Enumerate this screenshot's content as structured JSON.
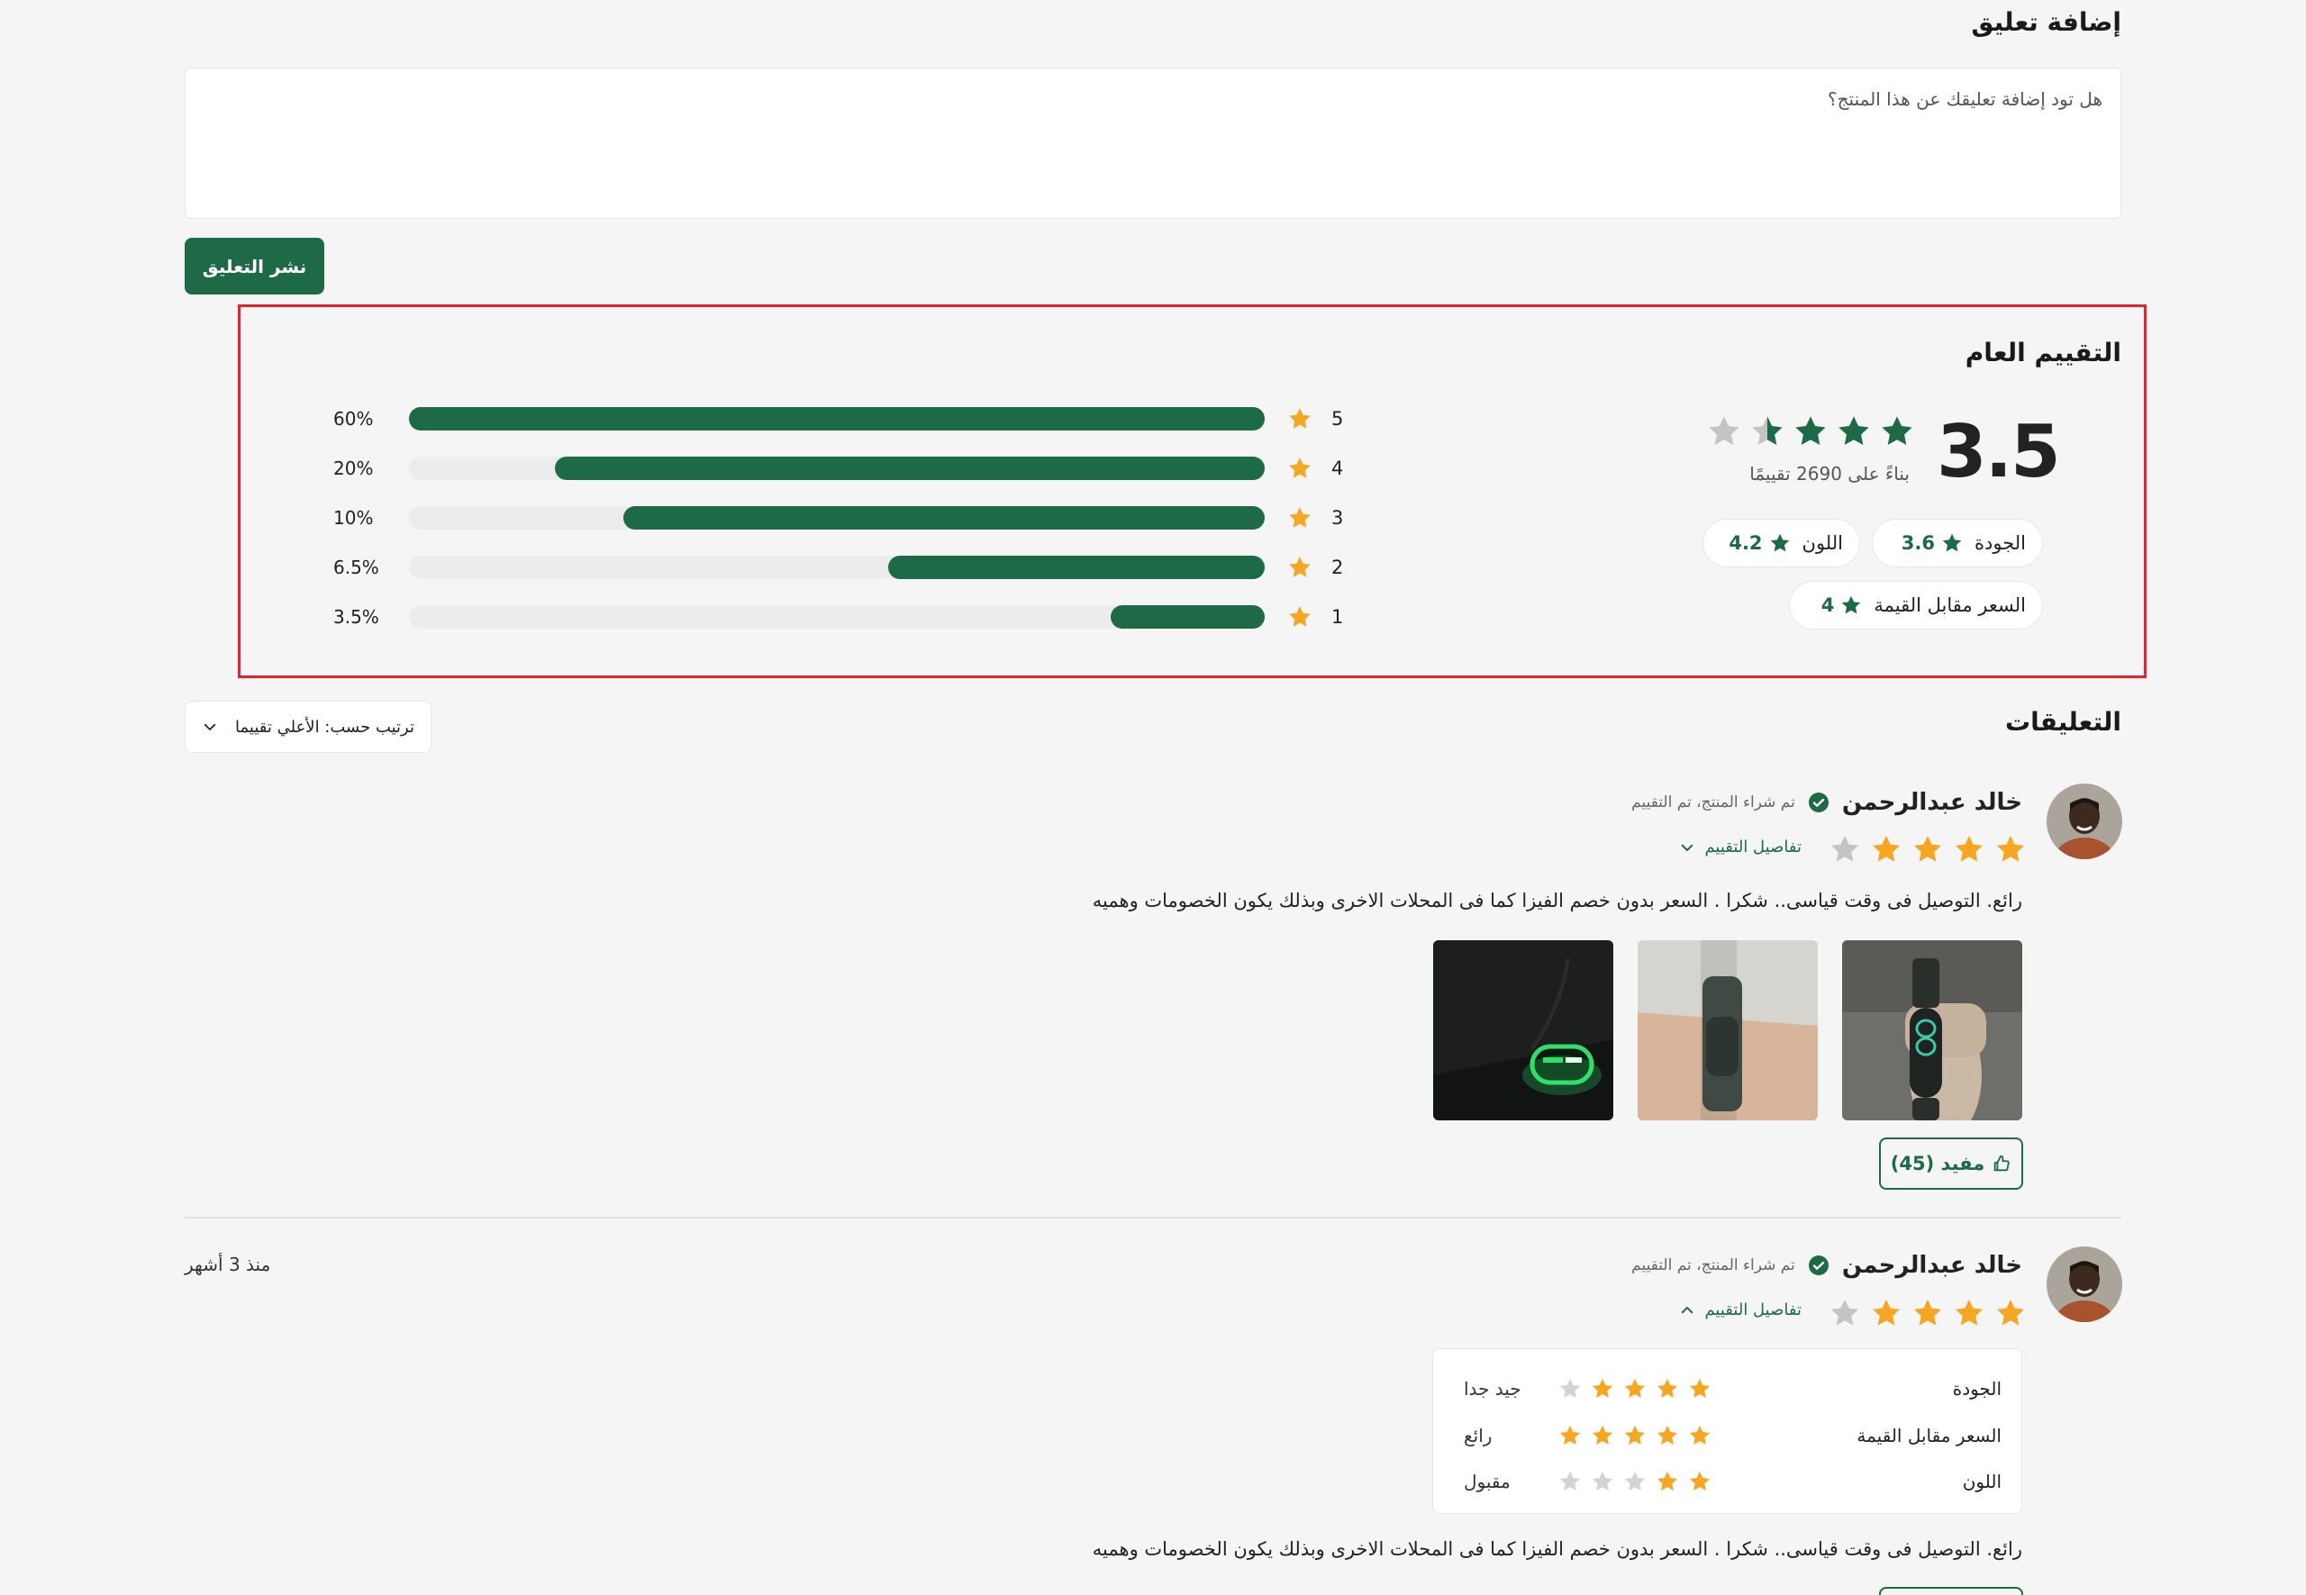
{
  "add_comment": {
    "title": "إضافة تعليق",
    "placeholder": "هل تود إضافة تعليقك عن هذا المنتج؟",
    "post_button": "نشر التعليق"
  },
  "overall": {
    "title": "التقييم العام",
    "score": "3.5",
    "stars": 3.5,
    "based_on": "بناءً على 2690 تقييمًا",
    "chips": [
      {
        "label": "الجودة",
        "value": "3.6"
      },
      {
        "label": "اللون",
        "value": "4.2"
      },
      {
        "label": "السعر مقابل القيمة",
        "value": "4"
      }
    ],
    "distribution": [
      {
        "stars": "5",
        "percent_label": "60%",
        "fill": 1.0
      },
      {
        "stars": "4",
        "percent_label": "20%",
        "fill": 0.83
      },
      {
        "stars": "3",
        "percent_label": "10%",
        "fill": 0.75
      },
      {
        "stars": "2",
        "percent_label": "6.5%",
        "fill": 0.44
      },
      {
        "stars": "1",
        "percent_label": "3.5%",
        "fill": 0.18
      }
    ]
  },
  "comments": {
    "title": "التعليقات",
    "sort_label": "ترتيب حسب: الأعلي تقييما",
    "reviews": [
      {
        "name": "خالد عبدالرحمن",
        "verified": "تم شراء المنتج، تم التقييم",
        "rating": 4,
        "details_label": "تفاصيل التقييم",
        "text": "رائع. التوصيل فى وقت قياسى.. شكرا . السعر بدون خصم الفيزا كما فى المحلات الاخرى وبذلك يكون الخصومات وهميه",
        "helpful_label": "مفيد (45)"
      },
      {
        "name": "خالد عبدالرحمن",
        "verified": "تم شراء المنتج، تم التقييم",
        "rating": 4,
        "time_ago": "منذ 3 أشهر",
        "details_label": "تفاصيل التقييم",
        "details": [
          {
            "label": "الجودة",
            "rating": 4,
            "word": "جيد جدا"
          },
          {
            "label": "السعر مقابل القيمة",
            "rating": 5,
            "word": "رائع"
          },
          {
            "label": "اللون",
            "rating": 2,
            "word": "مقبول"
          }
        ],
        "text": "رائع. التوصيل فى وقت قياسى.. شكرا . السعر بدون خصم الفيزا كما فى المحلات الاخرى وبذلك يكون الخصومات وهميه"
      }
    ]
  },
  "colors": {
    "brand_green": "#1e6a47",
    "star_orange": "#f5a623",
    "frame_red": "#e3262e"
  }
}
